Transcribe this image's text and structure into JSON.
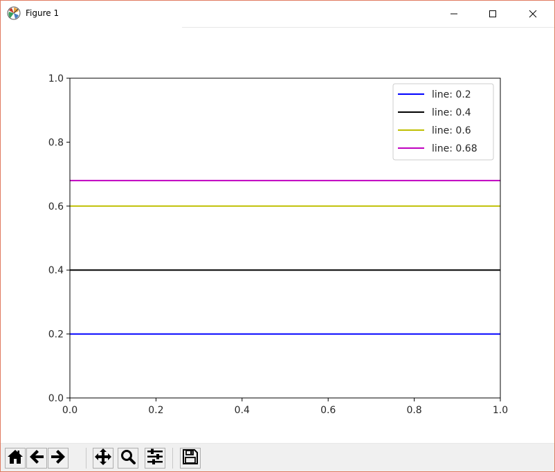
{
  "window": {
    "title": "Figure 1",
    "icons": {
      "app": "matplotlib-logo-icon",
      "minimize": "minimize-icon",
      "maximize": "maximize-icon",
      "close": "close-icon"
    }
  },
  "toolbar": {
    "buttons": [
      {
        "name": "home-button",
        "icon": "home-icon"
      },
      {
        "name": "back-button",
        "icon": "arrow-left-icon"
      },
      {
        "name": "forward-button",
        "icon": "arrow-right-icon"
      },
      {
        "name": "pan-button",
        "icon": "move-icon"
      },
      {
        "name": "zoom-button",
        "icon": "magnifier-icon"
      },
      {
        "name": "subplots-button",
        "icon": "sliders-icon"
      },
      {
        "name": "save-button",
        "icon": "floppy-disk-icon"
      }
    ]
  },
  "chart_data": {
    "type": "line",
    "title": "",
    "xlabel": "",
    "ylabel": "",
    "xlim": [
      0.0,
      1.0
    ],
    "ylim": [
      0.0,
      1.0
    ],
    "xticks": [
      "0.0",
      "0.2",
      "0.4",
      "0.6",
      "0.8",
      "1.0"
    ],
    "yticks": [
      "0.0",
      "0.2",
      "0.4",
      "0.6",
      "0.8",
      "1.0"
    ],
    "grid": false,
    "legend_position": "top-right",
    "series": [
      {
        "name": "line: 0.2",
        "x": [
          0.0,
          1.0
        ],
        "y": [
          0.2,
          0.2
        ],
        "color": "#0000ff"
      },
      {
        "name": "line: 0.4",
        "x": [
          0.0,
          1.0
        ],
        "y": [
          0.4,
          0.4
        ],
        "color": "#000000"
      },
      {
        "name": "line: 0.6",
        "x": [
          0.0,
          1.0
        ],
        "y": [
          0.6,
          0.6
        ],
        "color": "#bfbf00"
      },
      {
        "name": "line: 0.68",
        "x": [
          0.0,
          1.0
        ],
        "y": [
          0.68,
          0.68
        ],
        "color": "#bf00bf"
      }
    ]
  }
}
